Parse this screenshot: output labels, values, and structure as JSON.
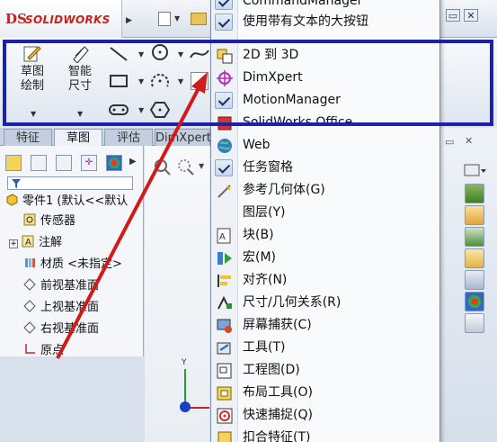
{
  "app": {
    "logo_prefix": "DS",
    "logo_text": "SOLIDWORKS"
  },
  "window_buttons": [
    "▭",
    "✕"
  ],
  "ribbon": {
    "sketch_label": "草图绘制",
    "smart_dim_label": "智能尺寸"
  },
  "tabs": [
    "特征",
    "草图",
    "评估",
    "DimXpert"
  ],
  "active_tab": "草图",
  "tree": {
    "part": "零件1 (默认<<默认",
    "items": [
      "传感器",
      "注解",
      "材质 <未指定>",
      "前视基准面",
      "上视基准面",
      "右视基准面",
      "原点"
    ]
  },
  "axis_label": "Y",
  "menu": {
    "items": [
      {
        "label": "CommandManager",
        "icon": "check-icon",
        "checked": true
      },
      {
        "label": "使用带有文本的大按钮",
        "icon": "check-icon",
        "checked": true
      },
      {
        "label": "2D 到 3D",
        "icon": "2d-to-3d-icon",
        "checked": false
      },
      {
        "label": "DimXpert",
        "icon": "dimxpert-icon",
        "checked": false
      },
      {
        "label": "MotionManager",
        "icon": "check-icon",
        "checked": true
      },
      {
        "label": "SolidWorks Office",
        "icon": "solidworks-office-icon",
        "checked": false
      },
      {
        "label": "Web",
        "icon": "globe-icon",
        "checked": false
      },
      {
        "label": "任务窗格",
        "icon": "check-icon",
        "checked": true
      },
      {
        "label": "参考几何体(G)",
        "icon": "reference-geometry-icon",
        "checked": false
      },
      {
        "label": "图层(Y)",
        "icon": "",
        "checked": false
      },
      {
        "label": "块(B)",
        "icon": "block-icon",
        "checked": false
      },
      {
        "label": "宏(M)",
        "icon": "macro-icon",
        "checked": false
      },
      {
        "label": "对齐(N)",
        "icon": "align-icon",
        "checked": false
      },
      {
        "label": "尺寸/几何关系(R)",
        "icon": "dimension-relation-icon",
        "checked": false
      },
      {
        "label": "屏幕捕获(C)",
        "icon": "screen-capture-icon",
        "checked": false
      },
      {
        "label": "工具(T)",
        "icon": "tools-icon",
        "checked": false
      },
      {
        "label": "工程图(D)",
        "icon": "drawing-icon",
        "checked": false
      },
      {
        "label": "布局工具(O)",
        "icon": "layout-tools-icon",
        "checked": false
      },
      {
        "label": "快速捕捉(Q)",
        "icon": "quick-snap-icon",
        "checked": false
      },
      {
        "label": "扣合特征(T)",
        "icon": "fastening-feature-icon",
        "checked": false
      }
    ]
  },
  "colors": {
    "highlight_box": "#1a22a8",
    "annotation_arrow": "#d21a1a",
    "brand_red": "#c7221d"
  }
}
